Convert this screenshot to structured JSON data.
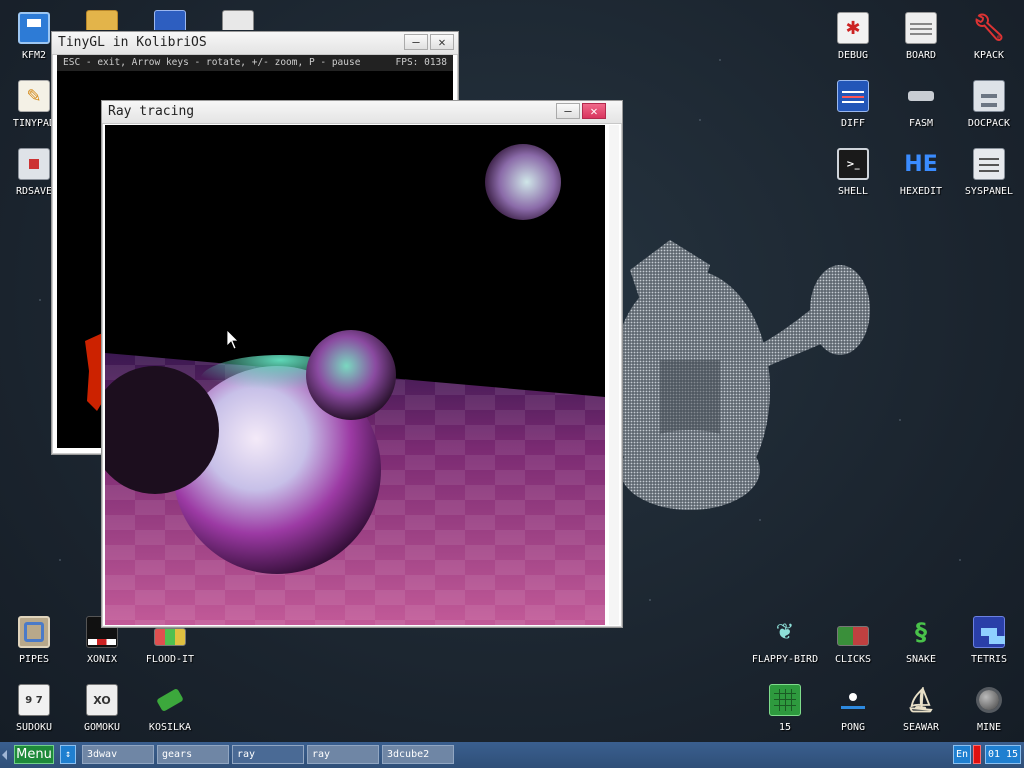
{
  "desktop": {
    "icons": {
      "kfm2": {
        "label": "KFM2",
        "icon": "floppy-icon"
      },
      "tinypad": {
        "label": "TINYPAD",
        "icon": "notepad-icon"
      },
      "rdsave": {
        "label": "RDSAVE",
        "icon": "rdsave-icon"
      },
      "debug": {
        "label": "DEBUG",
        "icon": "bug-icon"
      },
      "board": {
        "label": "BOARD",
        "icon": "board-icon"
      },
      "kpack": {
        "label": "KPACK",
        "icon": "wrench-icon"
      },
      "diff": {
        "label": "DIFF",
        "icon": "diff-icon"
      },
      "fasm": {
        "label": "FASM",
        "icon": "anvil-icon"
      },
      "docpack": {
        "label": "DOCPACK",
        "icon": "cabinet-icon"
      },
      "shell": {
        "label": "SHELL",
        "icon": "terminal-icon"
      },
      "hexedit": {
        "label": "HEXEDIT",
        "icon": "hex-icon",
        "glyph": "HE"
      },
      "syspanel": {
        "label": "SYSPANEL",
        "icon": "sliders-icon"
      },
      "pipes": {
        "label": "PIPES",
        "icon": "pipes-icon"
      },
      "xonix": {
        "label": "XONIX",
        "icon": "xonix-icon"
      },
      "floodit": {
        "label": "FLOOD-IT",
        "icon": "flood-icon"
      },
      "sudoku": {
        "label": "SUDOKU",
        "icon": "sudoku-icon"
      },
      "gomoku": {
        "label": "GOMOKU",
        "icon": "gomoku-icon"
      },
      "kosilka": {
        "label": "KOSILKA",
        "icon": "mower-icon"
      },
      "flappy": {
        "label": "FLAPPY-BIRD",
        "icon": "bird-icon"
      },
      "clicks": {
        "label": "CLICKS",
        "icon": "blocks-icon"
      },
      "snake": {
        "label": "SNAKE",
        "icon": "snake-icon"
      },
      "tetris": {
        "label": "TETRIS",
        "icon": "tetris-icon"
      },
      "fifteen": {
        "label": "15",
        "icon": "grid-icon"
      },
      "pong": {
        "label": "PONG",
        "icon": "paddle-icon"
      },
      "seawar": {
        "label": "SEAWAR",
        "icon": "ship-icon"
      },
      "mine": {
        "label": "MINE",
        "icon": "mine-icon"
      }
    }
  },
  "windows": {
    "tinygl": {
      "title": "TinyGL in KolibriOS",
      "status_left": "ESC - exit, Arrow keys - rotate, +/- zoom, P - pause",
      "status_right": "FPS: 0138",
      "minimize": "–",
      "close": "✕"
    },
    "ray": {
      "title": "Ray tracing",
      "minimize": "–",
      "close": "✕"
    }
  },
  "taskbar": {
    "menu_label": "Menu",
    "scroll_glyph": "↕",
    "tasks": [
      "3dwav",
      "gears",
      "ray",
      "ray",
      "3dcube2"
    ],
    "lang": "En",
    "clock": "01 15"
  },
  "colors": {
    "taskbar": "#2f4f78",
    "menu_button": "#1e8a3a",
    "close_button": "#d9345e",
    "accent_blue": "#1f7fd0"
  }
}
